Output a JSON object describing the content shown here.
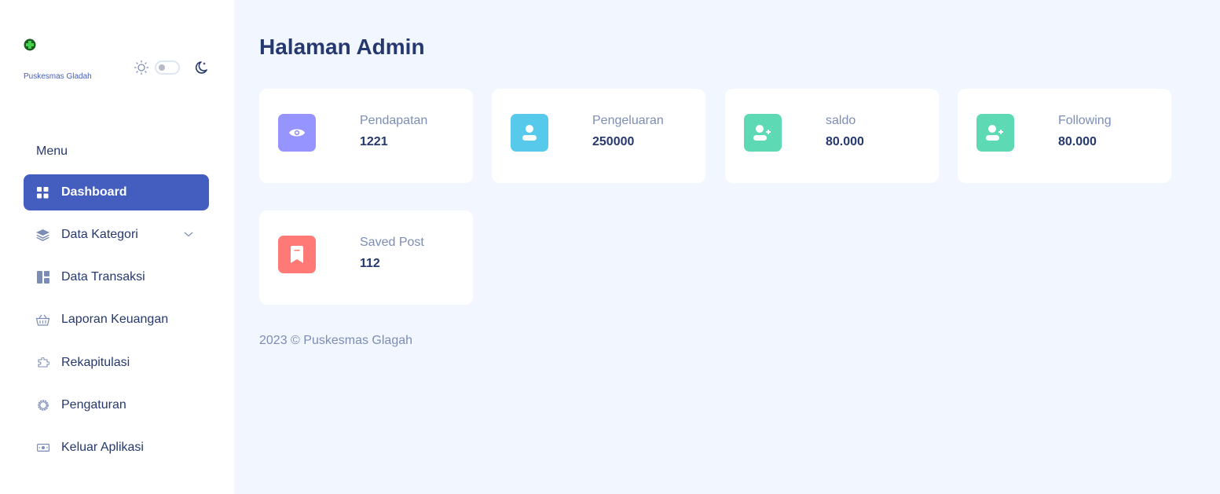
{
  "sidebar": {
    "brand": "Puskesmas Gladah",
    "menu_title": "Menu",
    "items": [
      {
        "label": "Dashboard",
        "icon": "grid-icon",
        "active": true
      },
      {
        "label": "Data Kategori",
        "icon": "stack-icon",
        "has_submenu": true
      },
      {
        "label": "Data Transaksi",
        "icon": "layout-icon"
      },
      {
        "label": "Laporan Keuangan",
        "icon": "basket-icon"
      },
      {
        "label": "Rekapitulasi",
        "icon": "puzzle-icon"
      },
      {
        "label": "Pengaturan",
        "icon": "gear-icon"
      },
      {
        "label": "Keluar Aplikasi",
        "icon": "cash-icon"
      }
    ]
  },
  "main": {
    "title": "Halaman Admin",
    "stats": [
      {
        "label": "Pendapatan",
        "value": "1221",
        "icon": "eye-icon",
        "color": "#9694ff"
      },
      {
        "label": "Pengeluaran",
        "value": "250000",
        "icon": "user-icon",
        "color": "#57caeb"
      },
      {
        "label": "saldo",
        "value": "80.000",
        "icon": "add-user-icon",
        "color": "#5ddab4"
      },
      {
        "label": "Following",
        "value": "80.000",
        "icon": "add-user-icon",
        "color": "#5ddab4"
      },
      {
        "label": "Saved Post",
        "value": "112",
        "icon": "bookmark-icon",
        "color": "#ff7976"
      }
    ]
  },
  "footer": {
    "text": "2023 © Puskesmas Glagah"
  },
  "colors": {
    "primary": "#435ebe",
    "background": "#f2f7ff",
    "text": "#25396f",
    "muted": "#7c8db5"
  }
}
